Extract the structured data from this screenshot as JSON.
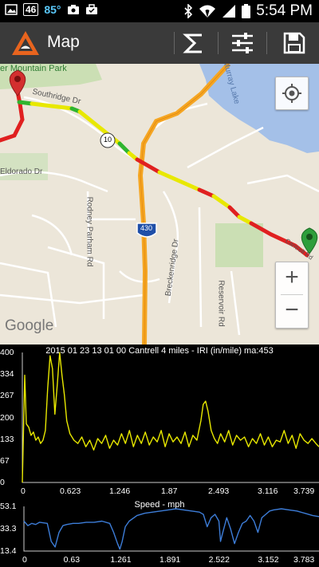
{
  "status_bar": {
    "badge": "46",
    "temperature": "85°",
    "time": "5:54 PM",
    "icons": [
      "image-icon",
      "lte-badge-icon",
      "photo-icon",
      "briefcase-icon",
      "bluetooth-icon",
      "wifi-icon",
      "signal-icon",
      "battery-icon"
    ]
  },
  "action_bar": {
    "title": "Map",
    "app_icon": "warning-triangle-icon",
    "actions": [
      "sigma-icon",
      "sliders-icon",
      "save-icon"
    ]
  },
  "map": {
    "labels": {
      "park": "er Mountain Park",
      "southridge": "Southridge Dr",
      "eldorado": "Eldorado Dr",
      "rodney": "Rodney Parham Rd",
      "breckenridge": "Breckenridge Dr",
      "reservoir": "Reservoir Rd",
      "murray": "Murray Lake",
      "shield_10": "10",
      "shield_430": "430",
      "cantrell": "Cantrell Rd",
      "google": "Google"
    },
    "controls": {
      "zoom_in": "+",
      "zoom_out": "−"
    },
    "marker_start_color": "#d32f2f",
    "marker_end_color": "#2e9e3c"
  },
  "chart_data": [
    {
      "type": "line",
      "title": "2015 01 23 13 01 00 Cantrell 4 miles - IRI (in/mile) ma:453",
      "y_tick_labels": [
        "400",
        "334",
        "267",
        "200",
        "133",
        "67",
        "0"
      ],
      "x_tick_labels": [
        "0",
        "0.623",
        "1.246",
        "1.87",
        "2.493",
        "3.116",
        "3.739"
      ],
      "xlim": [
        0,
        3.739
      ],
      "ylim": [
        0,
        400
      ],
      "line_color": "#e8e800",
      "series": [
        {
          "x": [
            0,
            0.03,
            0.05,
            0.08,
            0.11,
            0.14,
            0.17,
            0.2,
            0.23,
            0.26,
            0.29,
            0.32,
            0.35,
            0.38,
            0.41,
            0.44,
            0.47,
            0.5,
            0.53,
            0.56,
            0.6,
            0.65,
            0.7,
            0.75,
            0.8,
            0.85,
            0.9,
            0.95,
            1.0,
            1.05,
            1.1,
            1.15,
            1.2,
            1.25,
            1.3,
            1.35,
            1.4,
            1.45,
            1.5,
            1.55,
            1.6,
            1.65,
            1.7,
            1.75,
            1.8,
            1.85,
            1.9,
            1.95,
            2.0,
            2.05,
            2.1,
            2.15,
            2.2,
            2.25,
            2.28,
            2.31,
            2.34,
            2.38,
            2.42,
            2.46,
            2.5,
            2.55,
            2.6,
            2.65,
            2.7,
            2.75,
            2.8,
            2.85,
            2.9,
            2.95,
            3.0,
            3.05,
            3.1,
            3.15,
            3.2,
            3.25,
            3.3,
            3.35,
            3.4,
            3.45,
            3.5,
            3.55,
            3.6,
            3.65,
            3.7,
            3.739
          ],
          "values": [
            0,
            330,
            180,
            170,
            145,
            155,
            130,
            140,
            120,
            130,
            160,
            290,
            390,
            350,
            210,
            300,
            400,
            330,
            270,
            190,
            150,
            130,
            120,
            140,
            110,
            130,
            100,
            135,
            120,
            145,
            105,
            130,
            115,
            150,
            120,
            160,
            110,
            145,
            120,
            155,
            115,
            140,
            125,
            160,
            110,
            150,
            125,
            140,
            120,
            155,
            110,
            145,
            130,
            190,
            240,
            250,
            220,
            160,
            135,
            120,
            150,
            125,
            160,
            115,
            145,
            130,
            140,
            110,
            135,
            120,
            150,
            115,
            140,
            110,
            130,
            125,
            160,
            120,
            145,
            105,
            150,
            130,
            120,
            135,
            120,
            110
          ]
        }
      ]
    },
    {
      "type": "line",
      "title": "Speed - mph",
      "y_tick_labels": [
        "53.1",
        "33.3",
        "13.4"
      ],
      "x_tick_labels": [
        "0",
        "0.63",
        "1.261",
        "1.891",
        "2.522",
        "3.152",
        "3.783"
      ],
      "xlim": [
        0,
        3.783
      ],
      "ylim": [
        13.4,
        53.1
      ],
      "line_color": "#3d7dd8",
      "series": [
        {
          "x": [
            0,
            0.05,
            0.1,
            0.15,
            0.2,
            0.3,
            0.35,
            0.4,
            0.45,
            0.5,
            0.55,
            0.63,
            0.7,
            0.8,
            0.9,
            1.0,
            1.1,
            1.15,
            1.2,
            1.23,
            1.26,
            1.3,
            1.35,
            1.45,
            1.55,
            1.65,
            1.75,
            1.85,
            1.95,
            2.05,
            2.15,
            2.25,
            2.3,
            2.35,
            2.4,
            2.45,
            2.5,
            2.52,
            2.55,
            2.6,
            2.65,
            2.7,
            2.75,
            2.8,
            2.85,
            2.9,
            2.95,
            3.0,
            3.05,
            3.1,
            3.15,
            3.2,
            3.3,
            3.4,
            3.5,
            3.6,
            3.7,
            3.783
          ],
          "values": [
            40,
            36,
            38,
            37,
            39,
            38,
            22,
            17,
            30,
            36,
            37,
            38,
            38,
            39,
            39,
            40,
            38,
            30,
            20,
            15,
            22,
            35,
            40,
            45,
            47,
            48,
            49,
            50,
            51,
            50,
            49,
            48,
            46,
            35,
            43,
            46,
            40,
            22,
            30,
            43,
            33,
            20,
            30,
            38,
            40,
            45,
            40,
            30,
            43,
            46,
            49,
            50,
            51,
            50,
            49,
            47,
            45,
            44
          ]
        }
      ]
    }
  ]
}
